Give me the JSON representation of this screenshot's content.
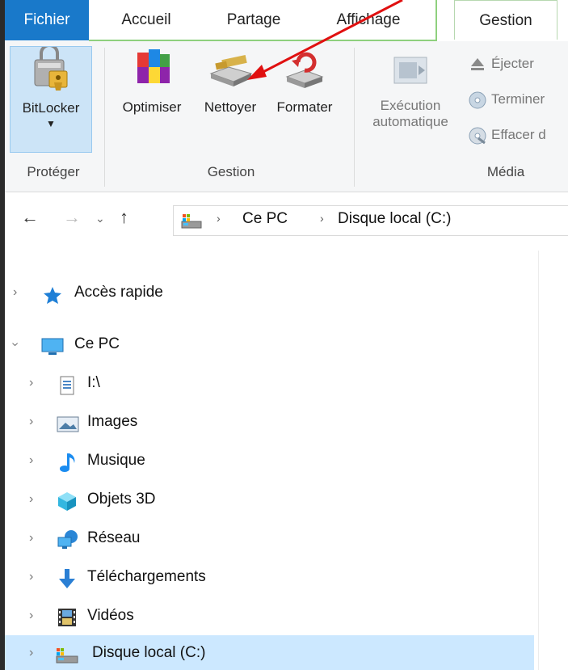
{
  "tabs": {
    "file": "Fichier",
    "accueil": "Accueil",
    "partage": "Partage",
    "affichage": "Affichage",
    "gestion": "Gestion"
  },
  "ribbon": {
    "proteger": {
      "label": "Protéger",
      "bitlocker": "BitLocker"
    },
    "gestion": {
      "label": "Gestion",
      "optimiser": "Optimiser",
      "nettoyer": "Nettoyer",
      "formater": "Formater"
    },
    "media": {
      "label": "Média",
      "execution_line1": "Exécution",
      "execution_line2": "automatique",
      "ejecter": "Éjecter",
      "terminer": "Terminer",
      "effacer": "Effacer d"
    }
  },
  "address": {
    "crumb1": "Ce PC",
    "crumb2": "Disque local (C:)"
  },
  "tree": {
    "acces_rapide": "Accès rapide",
    "ce_pc": "Ce PC",
    "drive_i": "I:\\",
    "images": "Images",
    "musique": "Musique",
    "objets3d": "Objets 3D",
    "reseau": "Réseau",
    "telechargements": "Téléchargements",
    "videos": "Vidéos",
    "disque_local": "Disque local (C:)"
  },
  "colors": {
    "file_tab": "#1979ca",
    "selected_row": "#cce8ff",
    "annotation_arrow": "#e01010"
  }
}
